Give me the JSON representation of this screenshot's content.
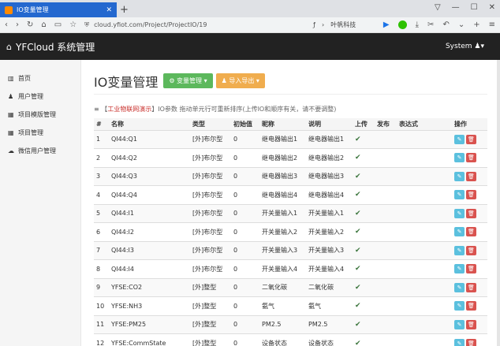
{
  "browser": {
    "tab_title": "IO变量管理",
    "url": "cloud.yfiot.com/Project/ProjectIO/19",
    "ext_label": "叶帆科技"
  },
  "app": {
    "brand": "YFCloud 系统管理",
    "user_menu": "System"
  },
  "sidebar": {
    "items": [
      {
        "label": "首页",
        "icon": "bar-chart-icon"
      },
      {
        "label": "用户管理",
        "icon": "user-icon"
      },
      {
        "label": "项目模版管理",
        "icon": "grid-icon"
      },
      {
        "label": "项目管理",
        "icon": "grid-icon"
      },
      {
        "label": "微信用户管理",
        "icon": "cloud-icon"
      }
    ]
  },
  "page": {
    "title": "IO变量管理",
    "btn_var": "变量管理",
    "btn_import": "导入导出",
    "notice_prefix": "【",
    "notice_link": "工业物联网演示",
    "notice_suffix": "】IO参数 拖动单元行可重新排序(上传IO和顺序有关，请不要调整)"
  },
  "table": {
    "headers": [
      "#",
      "名称",
      "类型",
      "初始值",
      "昵称",
      "说明",
      "上传",
      "发布",
      "表达式",
      "操作"
    ],
    "rows": [
      [
        "1",
        "QI44:Q1",
        "[外]布尔型",
        "0",
        "继电器输出1",
        "继电器输出1"
      ],
      [
        "2",
        "QI44:Q2",
        "[外]布尔型",
        "0",
        "继电器输出2",
        "继电器输出2"
      ],
      [
        "3",
        "QI44:Q3",
        "[外]布尔型",
        "0",
        "继电器输出3",
        "继电器输出3"
      ],
      [
        "4",
        "QI44:Q4",
        "[外]布尔型",
        "0",
        "继电器输出4",
        "继电器输出4"
      ],
      [
        "5",
        "QI44:I1",
        "[外]布尔型",
        "0",
        "开关量输入1",
        "开关量输入1"
      ],
      [
        "6",
        "QI44:I2",
        "[外]布尔型",
        "0",
        "开关量输入2",
        "开关量输入2"
      ],
      [
        "7",
        "QI44:I3",
        "[外]布尔型",
        "0",
        "开关量输入3",
        "开关量输入3"
      ],
      [
        "8",
        "QI44:I4",
        "[外]布尔型",
        "0",
        "开关量输入4",
        "开关量输入4"
      ],
      [
        "9",
        "YFSE:CO2",
        "[外]整型",
        "0",
        "二氧化碳",
        "二氧化碳"
      ],
      [
        "10",
        "YFSE:NH3",
        "[外]整型",
        "0",
        "氨气",
        "氨气"
      ],
      [
        "11",
        "YFSE:PM25",
        "[外]整型",
        "0",
        "PM2.5",
        "PM2.5"
      ],
      [
        "12",
        "YFSE:CommState",
        "[外]整型",
        "0",
        "设备状态",
        "设备状态"
      ]
    ]
  }
}
